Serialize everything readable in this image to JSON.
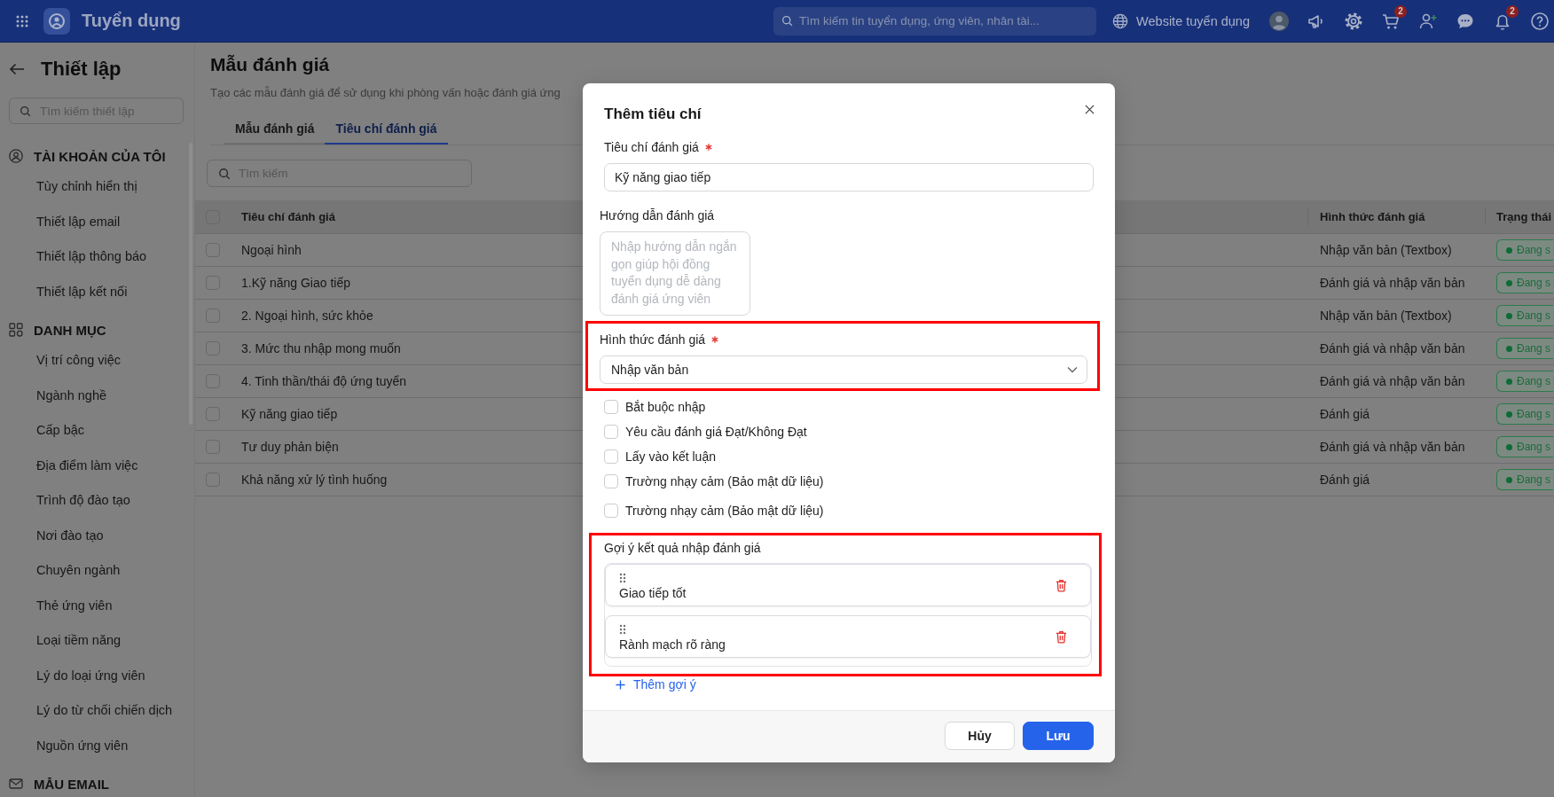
{
  "top_bar": {
    "app_name": "Tuyển dụng",
    "search": {
      "placeholder": "Tìm kiếm tin tuyển dụng, ứng viên, nhân tài..."
    },
    "website_link": "Website tuyển dụng",
    "cart_badge": "2",
    "notification_badge": "2"
  },
  "sidebar": {
    "title": "Thiết lập",
    "search": {
      "placeholder": "Tìm kiếm thiết lập"
    },
    "sections": [
      {
        "kind": "account",
        "title": "TÀI KHOẢN CỦA TÔI",
        "items": [
          {
            "label": "Tùy chỉnh hiển thị",
            "selected": false
          },
          {
            "label": "Thiết lập email",
            "selected": false
          },
          {
            "label": "Thiết lập thông báo",
            "selected": false
          },
          {
            "label": "Thiết lập kết nối",
            "selected": false
          }
        ]
      },
      {
        "kind": "catalog",
        "title": "DANH MỤC",
        "items": [
          {
            "label": "Vị trí công việc",
            "selected": false
          },
          {
            "label": "Ngành nghề",
            "selected": false
          },
          {
            "label": "Cấp bậc",
            "selected": false
          },
          {
            "label": "Địa điểm làm việc",
            "selected": false
          },
          {
            "label": "Trình độ đào tạo",
            "selected": false
          },
          {
            "label": "Nơi đào tạo",
            "selected": false
          },
          {
            "label": "Chuyên ngành",
            "selected": false
          },
          {
            "label": "Thẻ ứng viên",
            "selected": false
          },
          {
            "label": "Loại tiềm năng",
            "selected": false
          },
          {
            "label": "Lý do loại ứng viên",
            "selected": false
          },
          {
            "label": "Lý do từ chối chiến dịch",
            "selected": false
          },
          {
            "label": "Nguồn ứng viên",
            "selected": false
          }
        ]
      },
      {
        "kind": "email",
        "title": "MẪU EMAIL"
      }
    ]
  },
  "page": {
    "title": "Mẫu đánh giá",
    "subtitle": "Tạo các mẫu đánh giá để sử dụng khi phòng vấn hoặc đánh giá ứng",
    "tabs": [
      {
        "label": "Mẫu đánh giá",
        "selected": false
      },
      {
        "label": "Tiêu chí đánh giá",
        "selected": true
      }
    ],
    "search": {
      "placeholder": "Tìm kiếm"
    }
  },
  "table": {
    "select_all_checked": false,
    "columns": [
      "Tiêu chí đánh giá",
      "Hình thức đánh giá",
      "Trạng thái"
    ],
    "rows": [
      {
        "checked": false,
        "name": "Ngoại hình",
        "type": "Nhập văn bản (Textbox)",
        "status": "Đang s"
      },
      {
        "checked": false,
        "name": "1.Kỹ năng Giao tiếp",
        "type": "Đánh giá và nhập văn bản",
        "status": "Đang s"
      },
      {
        "checked": false,
        "name": "2. Ngoại hình, sức khỏe",
        "type": "Nhập văn bản (Textbox)",
        "status": "Đang s"
      },
      {
        "checked": false,
        "name": "3. Mức thu nhập mong muốn",
        "type": "Đánh giá và nhập văn bản",
        "status": "Đang s"
      },
      {
        "checked": false,
        "name": "4. Tinh thần/thái độ ứng tuyển",
        "type": "Đánh giá và nhập văn bản",
        "status": "Đang s"
      },
      {
        "checked": false,
        "name": "Kỹ năng giao tiếp",
        "type": "Đánh giá",
        "status": "Đang s"
      },
      {
        "checked": false,
        "name": "Tư duy phản biện",
        "type": "Đánh giá và nhập văn bản",
        "status": "Đang s"
      },
      {
        "checked": false,
        "name": "Khả năng xử lý tình huống",
        "type": "Đánh giá",
        "status": "Đang s"
      }
    ]
  },
  "dialog": {
    "title": "Thêm tiêu chí",
    "criterion": {
      "label": "Tiêu chí đánh giá",
      "required": true,
      "value": "Kỹ năng giao tiếp"
    },
    "guide": {
      "label": "Hướng dẫn đánh giá",
      "placeholder": "Nhập hướng dẫn ngắn gọn giúp hội đồng tuyển dụng dễ dàng đánh giá ứng viên"
    },
    "evaluation_type": {
      "label": "Hình thức đánh giá",
      "required": true,
      "value": "Nhập văn bản",
      "highlighted": true
    },
    "options": [
      {
        "label": "Bắt buộc nhập",
        "checked": false
      },
      {
        "label": "Yêu cầu đánh giá Đạt/Không Đạt",
        "checked": false
      },
      {
        "label": "Lấy vào kết luận",
        "checked": false
      },
      {
        "label": "Trường nhạy cảm (Bảo mật dữ liệu)",
        "checked": false
      },
      {
        "label": "Trường nhạy cảm (Bảo mật dữ liệu)",
        "checked": false
      }
    ],
    "suggestions": {
      "label": "Gợi ý kết quả nhập đánh giá",
      "highlighted": true,
      "items": [
        "Giao tiếp tốt",
        "Rành mạch rõ ràng"
      ],
      "add_label": "Thêm gợi ý"
    },
    "buttons": [
      {
        "label": "Hủy",
        "kind": "secondary"
      },
      {
        "label": "Lưu",
        "kind": "primary"
      }
    ]
  }
}
